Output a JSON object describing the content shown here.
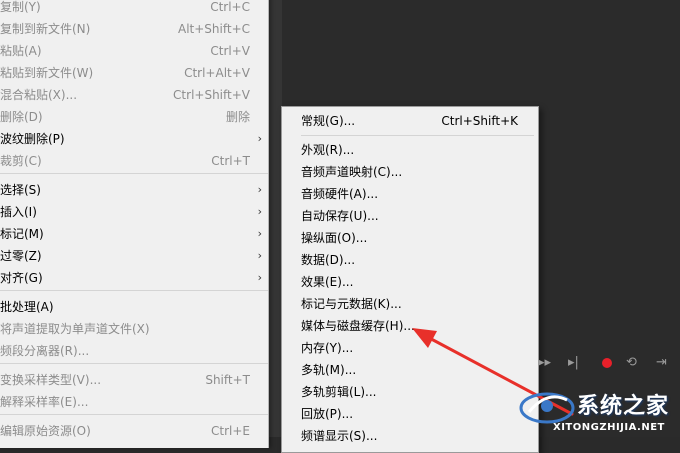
{
  "edit_menu": {
    "items": [
      {
        "label": "复制(Y)",
        "shortcut": "Ctrl+C",
        "disabled": true
      },
      {
        "label": "复制到新文件(N)",
        "shortcut": "Alt+Shift+C",
        "disabled": true
      },
      {
        "label": "粘贴(A)",
        "shortcut": "Ctrl+V",
        "disabled": true
      },
      {
        "label": "粘贴到新文件(W)",
        "shortcut": "Ctrl+Alt+V",
        "disabled": true
      },
      {
        "label": "混合粘贴(X)...",
        "shortcut": "Ctrl+Shift+V",
        "disabled": true
      },
      {
        "label": "删除(D)",
        "shortcut": "删除",
        "disabled": true
      },
      {
        "label": "波纹删除(P)",
        "shortcut": "",
        "disabled": false,
        "submenu": true
      },
      {
        "label": "裁剪(C)",
        "shortcut": "Ctrl+T",
        "disabled": true
      },
      {
        "label": "选择(S)",
        "shortcut": "",
        "disabled": false,
        "submenu": true
      },
      {
        "label": "插入(I)",
        "shortcut": "",
        "disabled": false,
        "submenu": true
      },
      {
        "label": "标记(M)",
        "shortcut": "",
        "disabled": false,
        "submenu": true
      },
      {
        "label": "过零(Z)",
        "shortcut": "",
        "disabled": false,
        "submenu": true
      },
      {
        "label": "对齐(G)",
        "shortcut": "",
        "disabled": false,
        "submenu": true
      },
      {
        "label": "批处理(A)",
        "shortcut": "",
        "disabled": false
      },
      {
        "label": "将声道提取为单声道文件(X)",
        "shortcut": "",
        "disabled": true
      },
      {
        "label": "频段分离器(R)...",
        "shortcut": "",
        "disabled": true
      },
      {
        "label": "变换采样类型(V)...",
        "shortcut": "Shift+T",
        "disabled": true
      },
      {
        "label": "解释采样率(E)...",
        "shortcut": "",
        "disabled": true
      },
      {
        "label": "编辑原始资源(O)",
        "shortcut": "Ctrl+E",
        "disabled": true
      }
    ],
    "submenu_arrow": "›"
  },
  "preferences_menu": {
    "items": [
      {
        "label": "常规(G)...",
        "shortcut": "Ctrl+Shift+K"
      },
      {
        "label": "外观(R)...",
        "shortcut": ""
      },
      {
        "label": "音频声道映射(C)...",
        "shortcut": ""
      },
      {
        "label": "音频硬件(A)...",
        "shortcut": ""
      },
      {
        "label": "自动保存(U)...",
        "shortcut": ""
      },
      {
        "label": "操纵面(O)...",
        "shortcut": ""
      },
      {
        "label": "数据(D)...",
        "shortcut": ""
      },
      {
        "label": "效果(E)...",
        "shortcut": ""
      },
      {
        "label": "标记与元数据(K)...",
        "shortcut": ""
      },
      {
        "label": "媒体与磁盘缓存(H)...",
        "shortcut": ""
      },
      {
        "label": "内存(Y)...",
        "shortcut": ""
      },
      {
        "label": "多轨(M)...",
        "shortcut": ""
      },
      {
        "label": "多轨剪辑(L)...",
        "shortcut": ""
      },
      {
        "label": "回放(P)...",
        "shortcut": ""
      },
      {
        "label": "频谱显示(S)...",
        "shortcut": ""
      }
    ]
  },
  "transport": {
    "fast_forward_icon": "▸▸",
    "skip_end_icon": "▸|",
    "loop_icon": "⟲",
    "skip_selection_icon": "⇥"
  },
  "watermark": {
    "name": "系统之家",
    "url": "XITONGZHIJIA.NET"
  },
  "colors": {
    "menu_bg": "#f0f0f0",
    "disabled_text": "#8c8c8c",
    "record": "#e8202a",
    "annotation_arrow": "#e8302a"
  }
}
